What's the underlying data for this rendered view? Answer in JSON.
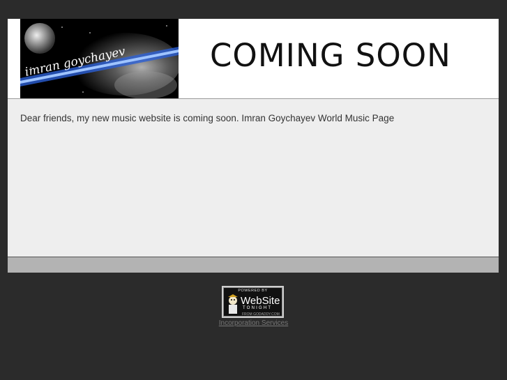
{
  "header": {
    "banner_text": "imran goychayev",
    "coming_soon": "COMING SOON"
  },
  "content": {
    "message": "Dear friends, my new music website is coming soon. Imran Goychayev World Music Page"
  },
  "badge": {
    "powered": "POWERED BY",
    "brand": "WebSite",
    "tonight": "TONIGHT",
    "from": "FROM GODADDY.COM"
  },
  "footer": {
    "link": "Incorporation Services"
  },
  "colors": {
    "page_bg": "#2b2b2b",
    "header_bg": "#ffffff",
    "content_bg": "#eeeeee",
    "footer_bar": "#b3b3b3"
  }
}
